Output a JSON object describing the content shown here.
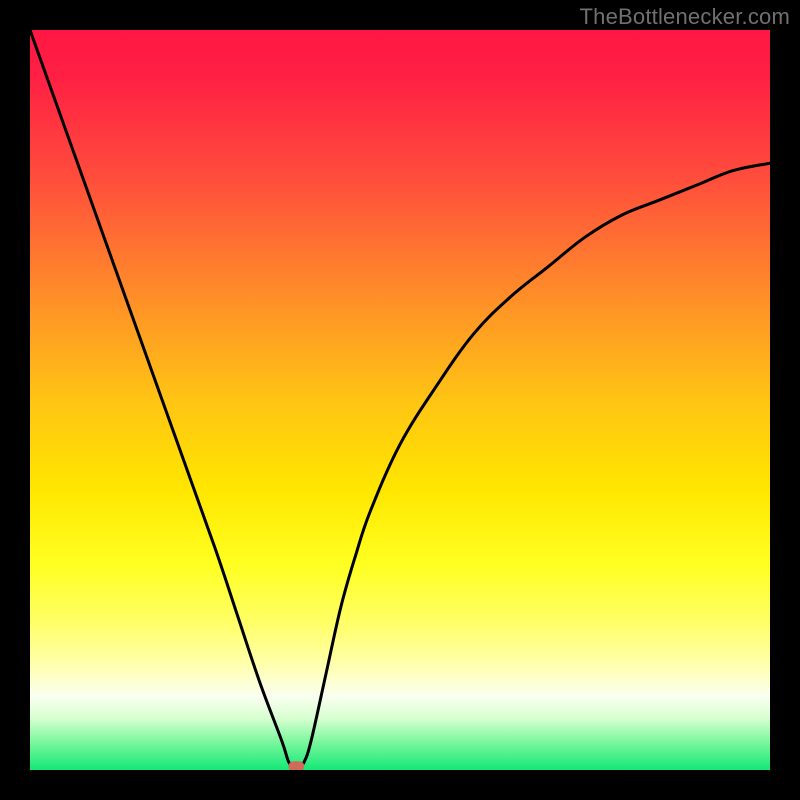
{
  "attribution": "TheBottlenecker.com",
  "chart_data": {
    "type": "line",
    "title": "",
    "xlabel": "",
    "ylabel": "",
    "xlim": [
      0,
      100
    ],
    "ylim": [
      0,
      100
    ],
    "series": [
      {
        "name": "bottleneck-curve",
        "x": [
          0,
          5,
          10,
          15,
          20,
          25,
          28,
          31,
          34,
          35,
          36,
          37,
          38,
          40,
          42,
          44,
          46,
          50,
          55,
          60,
          65,
          70,
          75,
          80,
          85,
          90,
          95,
          100
        ],
        "y": [
          100,
          86,
          72,
          58,
          44,
          30,
          21,
          12,
          4,
          1,
          0,
          1,
          4,
          13,
          22,
          29,
          35,
          44,
          52,
          59,
          64,
          68,
          72,
          75,
          77,
          79,
          81,
          82
        ]
      }
    ],
    "marker": {
      "x": 36,
      "y": 0.5,
      "color": "#d06a5a"
    },
    "gradient_stops": [
      {
        "offset": 0.0,
        "color": "#ff1744"
      },
      {
        "offset": 0.06,
        "color": "#ff1f44"
      },
      {
        "offset": 0.2,
        "color": "#ff4d3c"
      },
      {
        "offset": 0.35,
        "color": "#ff8a2a"
      },
      {
        "offset": 0.5,
        "color": "#ffc414"
      },
      {
        "offset": 0.62,
        "color": "#ffe600"
      },
      {
        "offset": 0.72,
        "color": "#ffff20"
      },
      {
        "offset": 0.8,
        "color": "#ffff66"
      },
      {
        "offset": 0.86,
        "color": "#ffffb0"
      },
      {
        "offset": 0.9,
        "color": "#fafff0"
      },
      {
        "offset": 0.93,
        "color": "#d8ffd0"
      },
      {
        "offset": 0.96,
        "color": "#80f8a0"
      },
      {
        "offset": 1.0,
        "color": "#14e878"
      }
    ]
  }
}
